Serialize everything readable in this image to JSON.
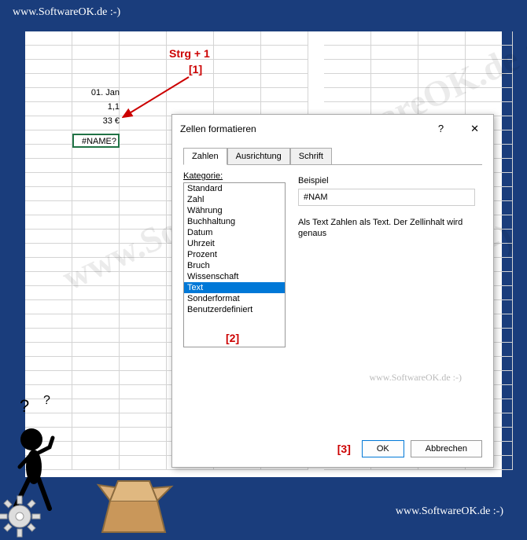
{
  "watermark": "www.SoftwareOK.de :-)",
  "annotations": {
    "strg": "Strg + 1",
    "m1": "[1]",
    "m2": "[2]",
    "m3": "[3]"
  },
  "cells": {
    "date": "01. Jan",
    "num": "1,1",
    "currency": "33 €",
    "selected": "#NAME?"
  },
  "dialog": {
    "title": "Zellen formatieren",
    "help": "?",
    "close": "✕",
    "tabs": [
      "Zahlen",
      "Ausrichtung",
      "Schrift"
    ],
    "category_label": "Kategorie:",
    "categories": [
      "Standard",
      "Zahl",
      "Währung",
      "Buchhaltung",
      "Datum",
      "Uhrzeit",
      "Prozent",
      "Bruch",
      "Wissenschaft",
      "Text",
      "Sonderformat",
      "Benutzerdefiniert"
    ],
    "selected_category": "Text",
    "sample_label": "Beispiel",
    "sample_value": "#NAM",
    "description": "Als Text Zahlen als Text. Der Zellinhalt wird genaus",
    "ok": "OK",
    "cancel": "Abbrechen"
  }
}
